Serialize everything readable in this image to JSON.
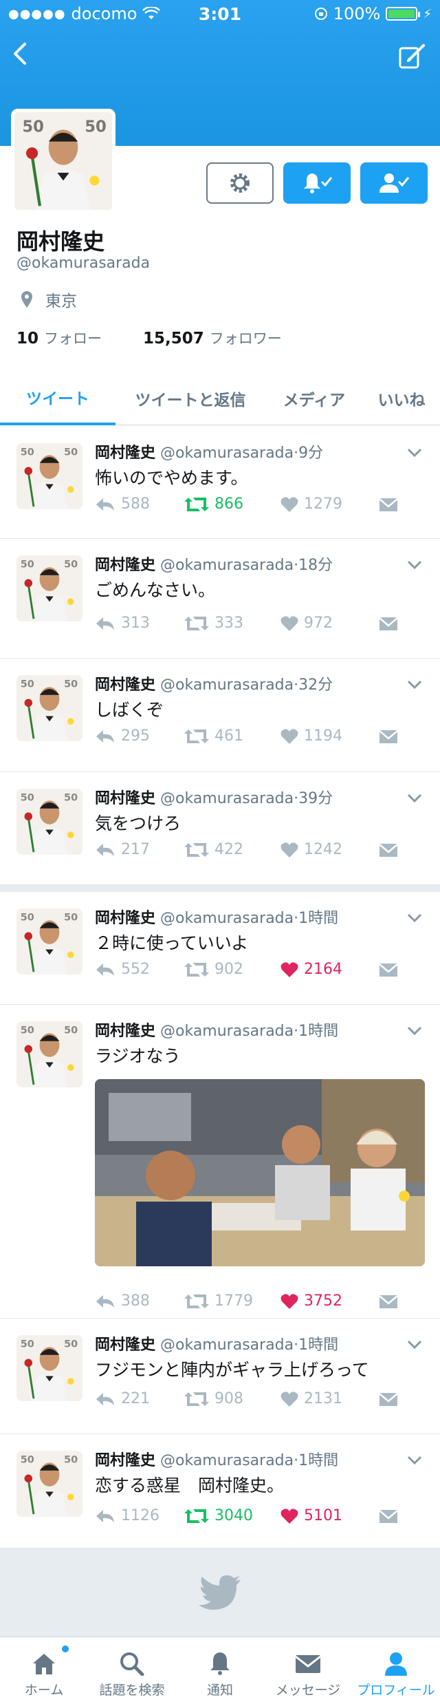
{
  "status_bar": {
    "carrier": "docomo",
    "time": "3:01",
    "battery": "100%"
  },
  "profile": {
    "name": "岡村隆史",
    "handle": "@okamurasarada",
    "location": "東京",
    "following_count": "10",
    "following_label": "フォロー",
    "followers_count": "15,507",
    "followers_label": "フォロワー"
  },
  "tabs": [
    "ツイート",
    "ツイートと返信",
    "メディア",
    "いいね"
  ],
  "tweets": [
    {
      "name": "岡村隆史",
      "handle": "@okamurasarada",
      "time": "9分",
      "text": "怖いのでやめます。",
      "replies": "588",
      "retweets": "866",
      "likes": "1279",
      "retweeted": true,
      "liked": false
    },
    {
      "name": "岡村隆史",
      "handle": "@okamurasarada",
      "time": "18分",
      "text": "ごめんなさい。",
      "replies": "313",
      "retweets": "333",
      "likes": "972",
      "retweeted": false,
      "liked": false
    },
    {
      "name": "岡村隆史",
      "handle": "@okamurasarada",
      "time": "32分",
      "text": "しばくぞ",
      "replies": "295",
      "retweets": "461",
      "likes": "1194",
      "retweeted": false,
      "liked": false
    },
    {
      "name": "岡村隆史",
      "handle": "@okamurasarada",
      "time": "39分",
      "text": "気をつけろ",
      "replies": "217",
      "retweets": "422",
      "likes": "1242",
      "retweeted": false,
      "liked": false
    },
    {
      "name": "岡村隆史",
      "handle": "@okamurasarada",
      "time": "1時間",
      "text": "２時に使っていいよ",
      "replies": "552",
      "retweets": "902",
      "likes": "2164",
      "retweeted": false,
      "liked": true
    },
    {
      "name": "岡村隆史",
      "handle": "@okamurasarada",
      "time": "1時間",
      "text": "ラジオなう",
      "replies": "388",
      "retweets": "1779",
      "likes": "3752",
      "retweeted": false,
      "liked": true
    },
    {
      "name": "岡村隆史",
      "handle": "@okamurasarada",
      "time": "1時間",
      "text": "フジモンと陣内がギャラ上げろって",
      "replies": "221",
      "retweets": "908",
      "likes": "2131",
      "retweeted": false,
      "liked": false
    },
    {
      "name": "岡村隆史",
      "handle": "@okamurasarada",
      "time": "1時間",
      "text": "恋する惑星　岡村隆史。",
      "replies": "1126",
      "retweets": "3040",
      "likes": "5101",
      "retweeted": true,
      "liked": true
    }
  ],
  "tabbar": [
    "ホーム",
    "話題を検索",
    "通知",
    "メッセージ",
    "プロフィール"
  ],
  "colors": {
    "brand_blue": "#1da1f2",
    "retweet_green": "#17bf63",
    "like_red": "#e0245e"
  }
}
